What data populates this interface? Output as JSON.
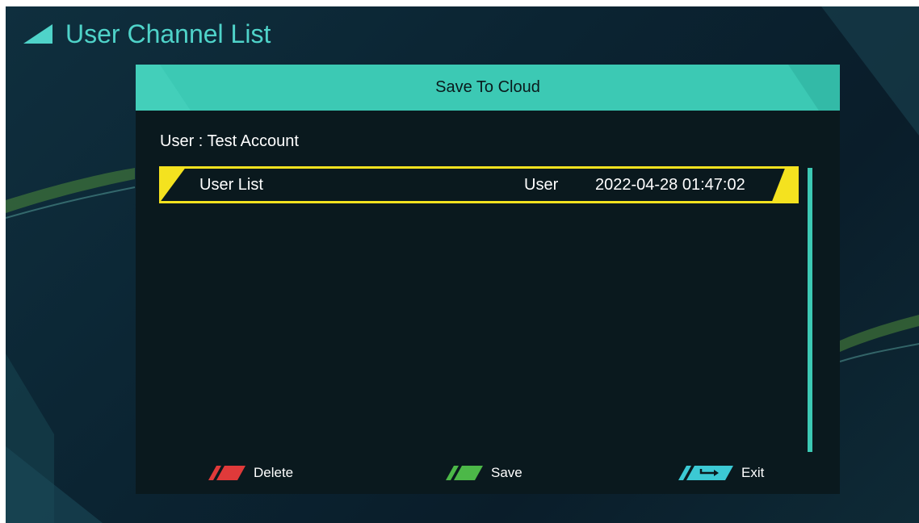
{
  "page": {
    "title": "User Channel List",
    "title_icon": "triangle-icon"
  },
  "dialog": {
    "title": "Save To Cloud",
    "user_label": "User : Test Account"
  },
  "list": {
    "rows": [
      {
        "name": "User List",
        "type": "User",
        "date": "2022-04-28 01:47:02",
        "selected": true
      }
    ]
  },
  "footer": {
    "keys": [
      {
        "label": "Delete",
        "color": "#e03a3a",
        "icon": "red-key-icon"
      },
      {
        "label": "Save",
        "color": "#4cb848",
        "icon": "green-key-icon"
      },
      {
        "label": "Exit",
        "color": "#3cc9d4",
        "icon": "exit-key-icon"
      }
    ]
  },
  "colors": {
    "accent": "#3cc9b4",
    "highlight": "#f4e21f",
    "title_text": "#4fd3c9",
    "panel": "#0a191e"
  }
}
